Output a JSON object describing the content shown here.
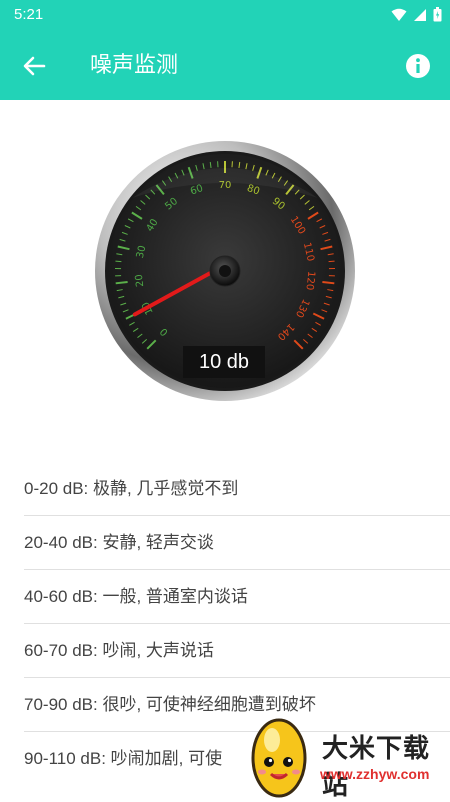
{
  "status": {
    "time": "5:21"
  },
  "header": {
    "title": "噪声监测"
  },
  "gauge": {
    "ticks": [
      "0",
      "10",
      "20",
      "30",
      "40",
      "50",
      "60",
      "70",
      "80",
      "90",
      "100",
      "110",
      "120",
      "130",
      "140"
    ],
    "value": 10,
    "min": 0,
    "max": 140,
    "readout": "10 db"
  },
  "levels": [
    "0-20 dB: 极静, 几乎感觉不到",
    "20-40 dB: 安静, 轻声交谈",
    "40-60 dB: 一般, 普通室内谈话",
    "60-70 dB: 吵闹, 大声说话",
    "70-90 dB: 很吵, 可使神经细胞遭到破坏",
    "90-110 dB: 吵闹加剧, 可使"
  ],
  "watermark": {
    "name": "大米下载站",
    "url": "www.zzhyw.com"
  }
}
